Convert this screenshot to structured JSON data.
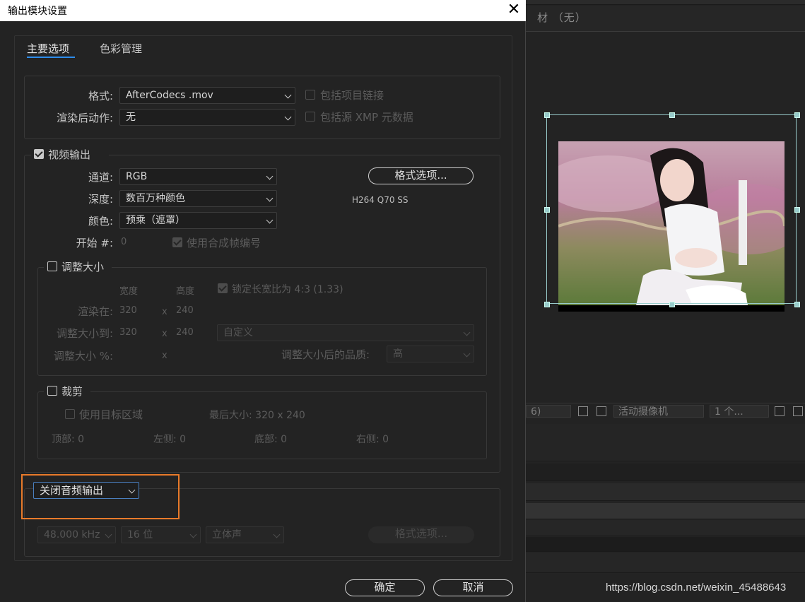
{
  "dialog": {
    "title": "输出模块设置",
    "close_glyph": "✕",
    "tabs": [
      "主要选项",
      "色彩管理"
    ],
    "format": {
      "label": "格式:",
      "value": "AfterCodecs .mov",
      "include_project_link": "包括项目链接"
    },
    "post_render": {
      "label": "渲染后动作:",
      "value": "无",
      "include_xmp": "包括源 XMP 元数据"
    },
    "video": {
      "header": "视频输出",
      "channels": {
        "label": "通道:",
        "value": "RGB"
      },
      "depth": {
        "label": "深度:",
        "value": "数百万种颜色"
      },
      "color": {
        "label": "颜色:",
        "value": "预乘（遮罩）"
      },
      "start": {
        "label": "开始 #:",
        "value": "0",
        "use_comp_frame": "使用合成帧编号"
      },
      "format_options_button": "格式选项...",
      "codec_summary": "H264 Q70 SS"
    },
    "resize": {
      "header": "调整大小",
      "width_col": "宽度",
      "height_col": "高度",
      "lock_aspect": "锁定长宽比为 4:3 (1.33)",
      "render_at": {
        "label": "渲染在:",
        "w": "320",
        "h": "240"
      },
      "resize_to": {
        "label": "调整大小到:",
        "w": "320",
        "h": "240",
        "preset": "自定义"
      },
      "resize_pct": {
        "label": "调整大小 %:"
      },
      "quality": {
        "label": "调整大小后的品质:",
        "value": "高"
      },
      "x": "x"
    },
    "crop": {
      "header": "裁剪",
      "use_roi": "使用目标区域",
      "final_size": "最后大小: 320 x 240",
      "top": "顶部:  0",
      "left": "左侧:  0",
      "bottom": "底部:  0",
      "right": "右侧:  0"
    },
    "audio": {
      "mode": "关闭音频输出",
      "sample_rate": "48.000 kHz",
      "bit_depth": "16 位",
      "channels": "立体声",
      "format_options_button": "格式选项..."
    },
    "ok_button": "确定",
    "cancel_button": "取消"
  },
  "background": {
    "panel_title": "材 （无）",
    "camera": "活动摄像机",
    "views": "1 个...",
    "left_fragment": "6)"
  },
  "watermark": "https://blog.csdn.net/weixin_45488643"
}
